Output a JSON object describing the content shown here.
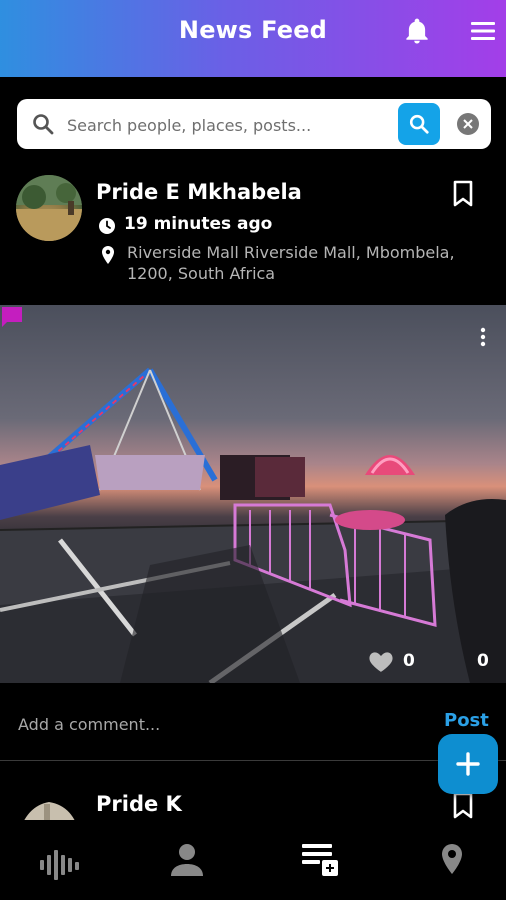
{
  "header": {
    "title": "News Feed",
    "icons": [
      "bell-icon",
      "menu-icon"
    ],
    "gradient": [
      "#2f8fe0",
      "#a33ee8"
    ]
  },
  "search": {
    "placeholder": "Search people, places, posts...",
    "value": "",
    "button_color": "#14a3e8"
  },
  "posts": [
    {
      "author": "Pride E Mkhabela",
      "time": "19 minutes ago",
      "location": "Riverside Mall  Riverside Mall, Mbombela, 1200, South Africa",
      "likes": "0",
      "comments": "0",
      "comment_placeholder": "Add a comment...",
      "post_label": "Post"
    },
    {
      "author": "Pride K"
    }
  ],
  "fab": {
    "icon": "plus-icon",
    "color": "#0e8ed0"
  },
  "bottom_nav": {
    "items": [
      "audio-icon",
      "profile-icon",
      "feed-icon",
      "location-icon"
    ],
    "active": "feed-icon"
  },
  "colors": {
    "accent": "#2ba0e6",
    "comment_icon": "#c41ebf"
  }
}
